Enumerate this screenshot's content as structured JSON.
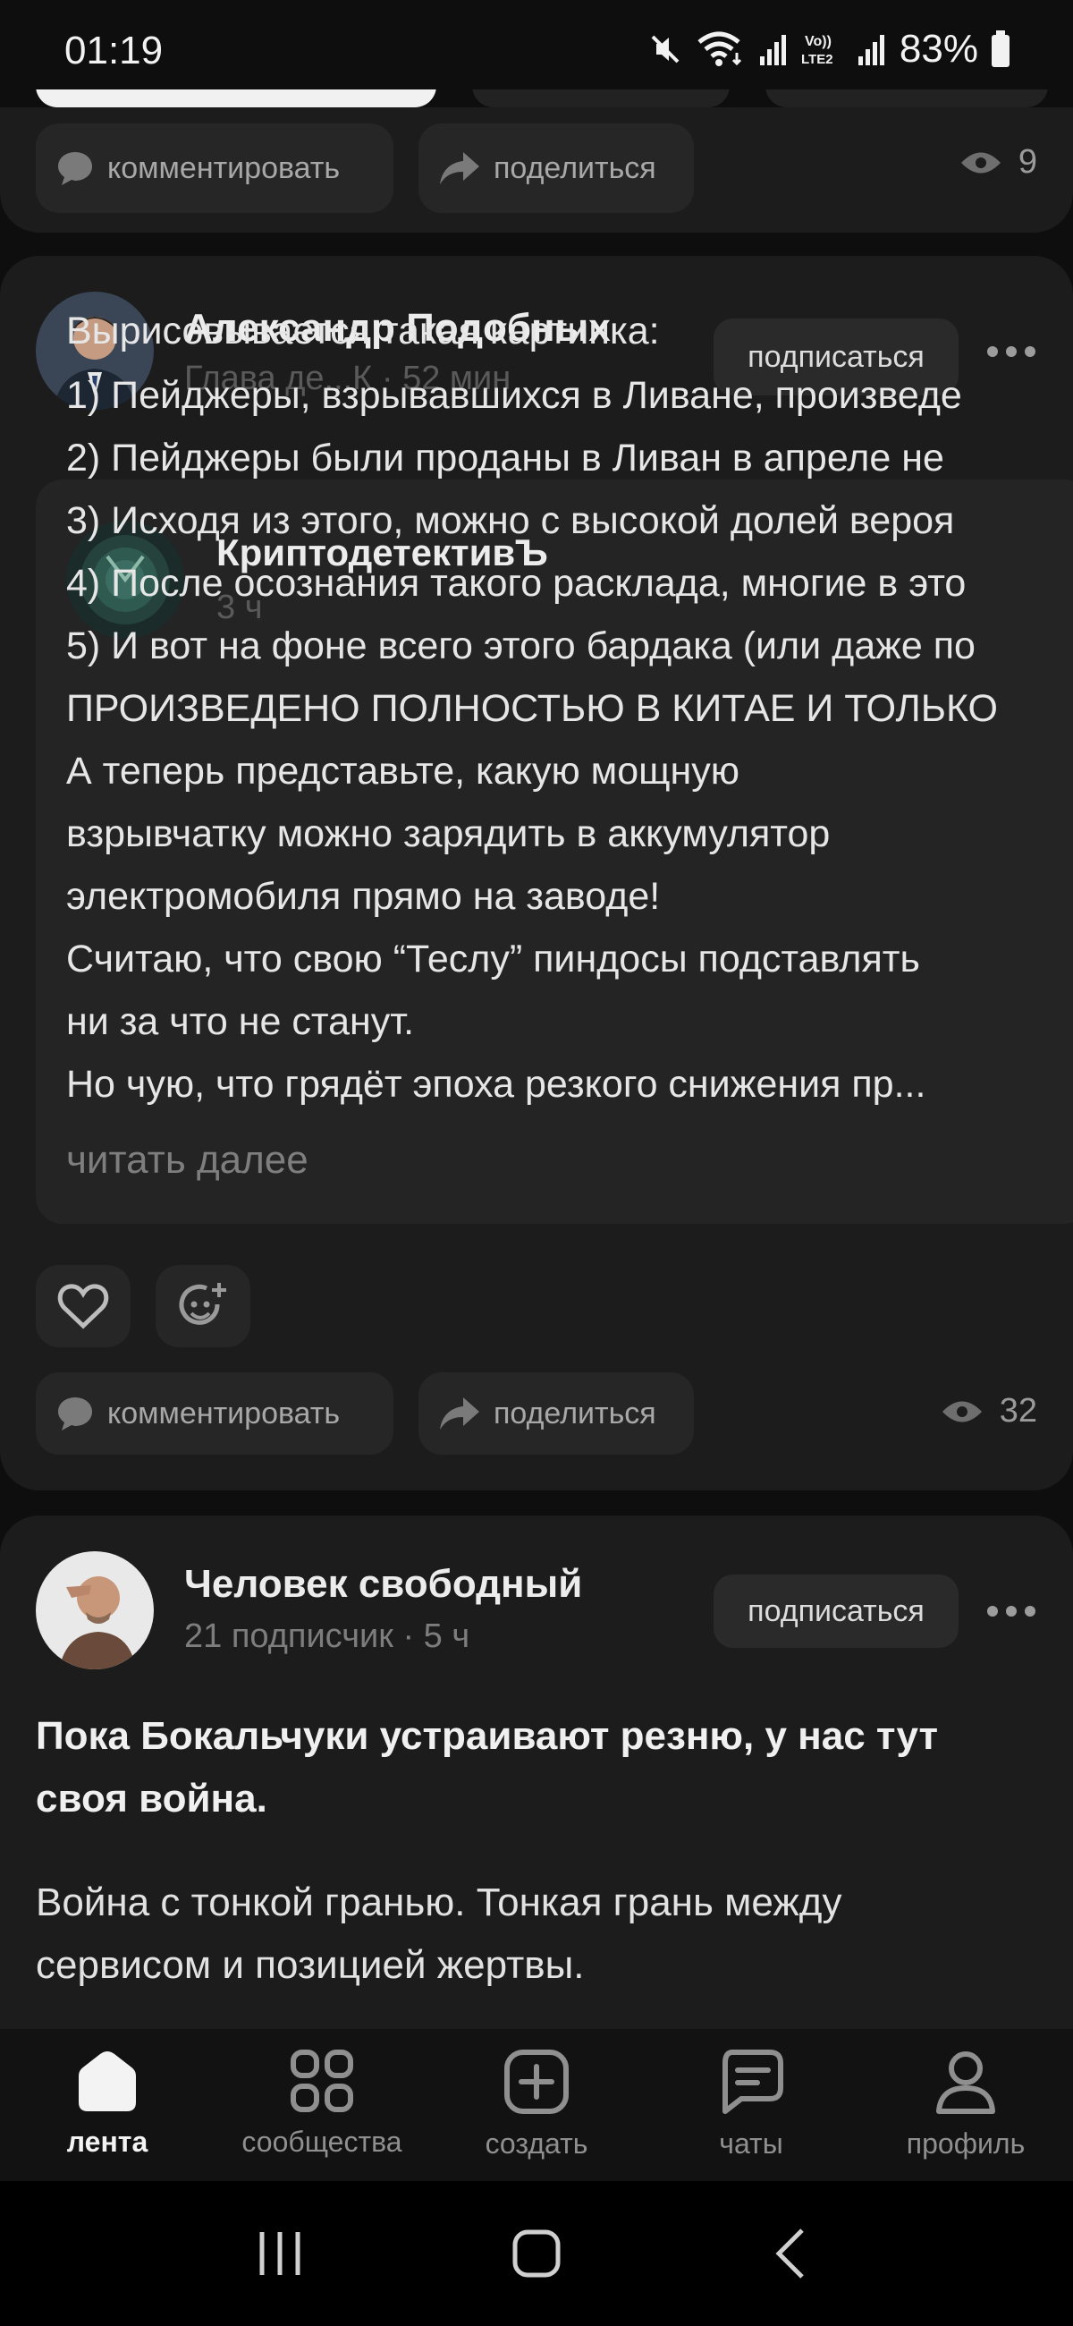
{
  "status_bar": {
    "time": "01:19",
    "volte": "Vo)) LTE2",
    "battery": "83%"
  },
  "top_post": {
    "comment_label": "комментировать",
    "share_label": "поделиться",
    "views": "9"
  },
  "repost_post": {
    "author_name": "Александр Подобных",
    "author_meta": "Глава де...К · 52 мин",
    "subscribe_label": "подписаться",
    "inner": {
      "author_name": "КриптодетективЪ",
      "author_meta": "3 ч",
      "lines": [
        "Вырисовывается такая картинка:",
        "1) Пейджеры, взрывавшихся в Ливане, произведе",
        "2) Пейджеры были проданы в Ливан в апреле не",
        "3) Исходя из этого, можно с высокой долей вероя",
        "4) После осознания такого расклада, многие в это",
        "5) И вот на фоне всего этого бардака (или даже по",
        "ПРОИЗВЕДЕНО ПОЛНОСТЬЮ В КИТАЕ И ТОЛЬКО",
        "А теперь представьте, какую мощную",
        "взрывчатку можно зарядить в аккумулятор",
        "электромобиля прямо на заводе!",
        "Считаю, что свою “Теслу” пиндосы подставлять",
        "ни за что не станут.",
        "Но чую, что грядёт эпоха резкого снижения пр..."
      ],
      "read_more": "читать далее"
    },
    "comment_label": "комментировать",
    "share_label": "поделиться",
    "views": "32"
  },
  "bottom_post": {
    "author_name": "Человек свободный",
    "author_meta": "21 подписчик · 5 ч",
    "subscribe_label": "подписаться",
    "title": "Пока Бокальчуки устраивают резню, у нас тут своя война.",
    "body": "Война с тонкой гранью. Тонкая грань между сервисом и позицией жертвы."
  },
  "tabs": [
    {
      "label": "лента",
      "icon": "home-icon",
      "active": true
    },
    {
      "label": "сообщества",
      "icon": "grid-icon",
      "active": false
    },
    {
      "label": "создать",
      "icon": "plus-square-icon",
      "active": false
    },
    {
      "label": "чаты",
      "icon": "chat-icon",
      "active": false
    },
    {
      "label": "профиль",
      "icon": "profile-icon",
      "active": false
    }
  ],
  "colors": {
    "background": "#0e0e0e",
    "card": "#1c1c1c",
    "pill": "#262626",
    "text_primary": "#e6e6e6",
    "text_muted": "#7e7e7e"
  }
}
